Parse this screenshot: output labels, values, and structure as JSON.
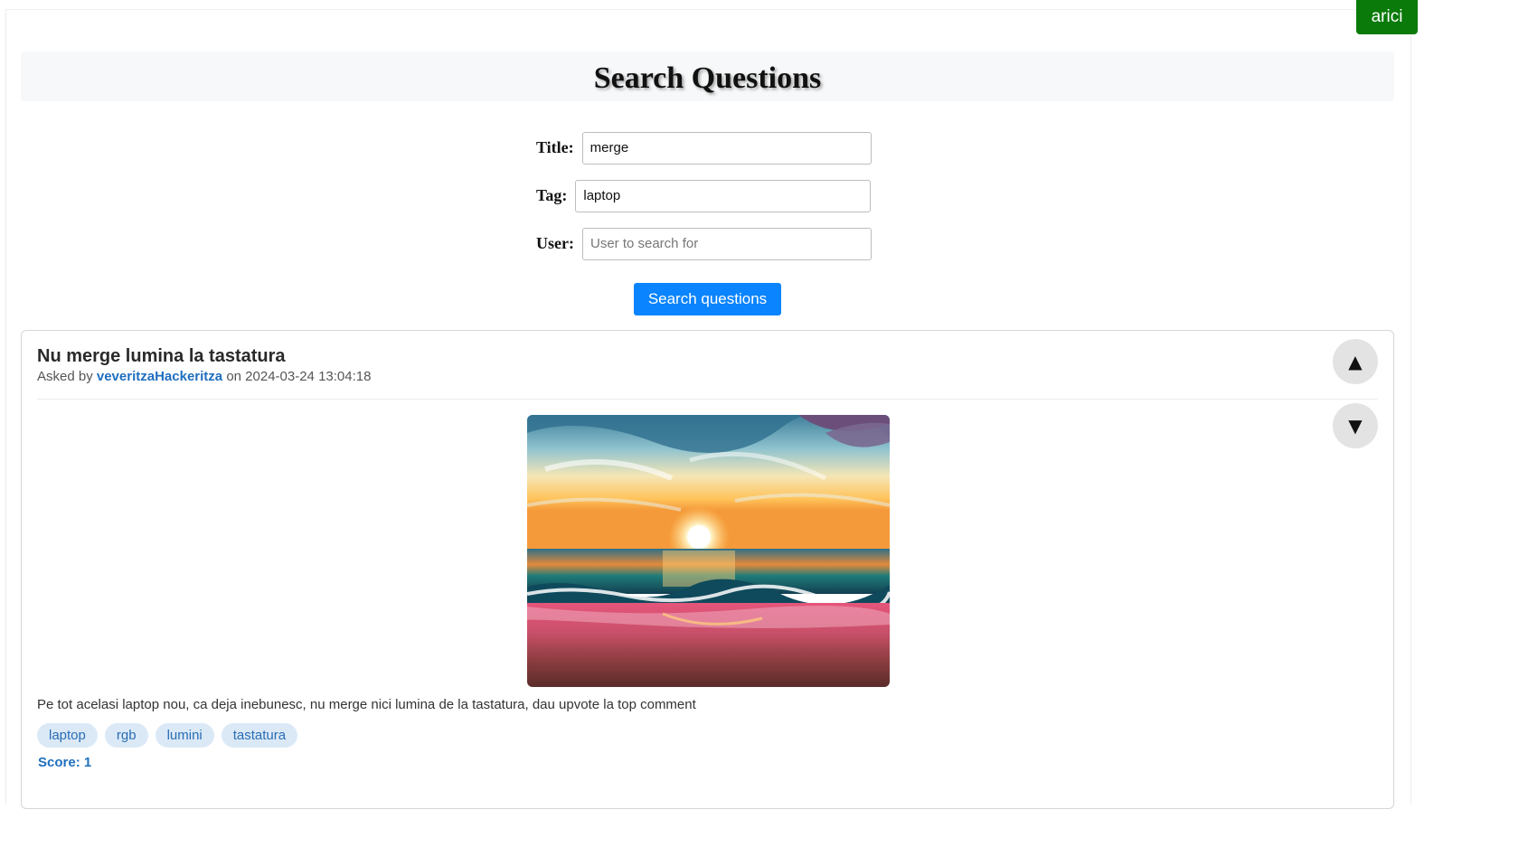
{
  "user": {
    "name": "arici"
  },
  "header": {
    "title": "Search Questions"
  },
  "search_form": {
    "title_label": "Title:",
    "title_value": "merge",
    "tag_label": "Tag:",
    "tag_value": "laptop",
    "user_label": "User:",
    "user_value": "",
    "user_placeholder": "User to search for",
    "submit_label": "Search questions"
  },
  "colors": {
    "user_badge": "#0a7a0a",
    "primary_button": "#0a84ff",
    "link": "#1f6fbf",
    "tag_background": "#dbe9f7"
  },
  "questions": [
    {
      "title": "Nu merge lumina la tastatura",
      "asked_by_prefix": "Asked by",
      "author": "veveritzaHackeritza",
      "date_prefix": "on",
      "date": "2024-03-24 13:04:18",
      "vote_up_icon": "▲",
      "vote_down_icon": "▼",
      "image": "sunset-over-sea-painting",
      "body": "Pe tot acelasi laptop nou, ca deja inebunesc, nu merge nici lumina de la tastatura, dau upvote la top comment",
      "tags": [
        "laptop",
        "rgb",
        "lumini",
        "tastatura"
      ],
      "score_text": "Score: 1"
    }
  ]
}
